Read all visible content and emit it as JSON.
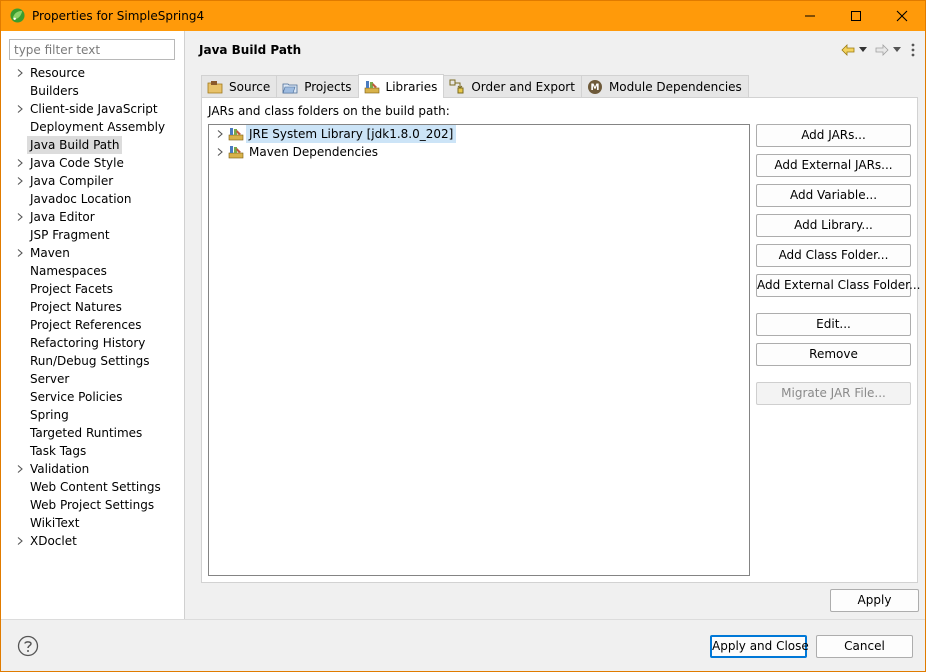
{
  "window": {
    "title": "Properties for SimpleSpring4",
    "controls": {
      "minimize": "minimize-icon",
      "maximize": "maximize-icon",
      "close": "close-icon"
    },
    "accent_color": "#ff9a0a"
  },
  "sidebar": {
    "filter_placeholder": "type filter text",
    "items": [
      {
        "label": "Resource",
        "expandable": true
      },
      {
        "label": "Builders",
        "expandable": false
      },
      {
        "label": "Client-side JavaScript",
        "expandable": true
      },
      {
        "label": "Deployment Assembly",
        "expandable": false
      },
      {
        "label": "Java Build Path",
        "expandable": false,
        "selected": true
      },
      {
        "label": "Java Code Style",
        "expandable": true
      },
      {
        "label": "Java Compiler",
        "expandable": true
      },
      {
        "label": "Javadoc Location",
        "expandable": false
      },
      {
        "label": "Java Editor",
        "expandable": true
      },
      {
        "label": "JSP Fragment",
        "expandable": false
      },
      {
        "label": "Maven",
        "expandable": true
      },
      {
        "label": "Namespaces",
        "expandable": false
      },
      {
        "label": "Project Facets",
        "expandable": false
      },
      {
        "label": "Project Natures",
        "expandable": false
      },
      {
        "label": "Project References",
        "expandable": false
      },
      {
        "label": "Refactoring History",
        "expandable": false
      },
      {
        "label": "Run/Debug Settings",
        "expandable": false
      },
      {
        "label": "Server",
        "expandable": false
      },
      {
        "label": "Service Policies",
        "expandable": false
      },
      {
        "label": "Spring",
        "expandable": false
      },
      {
        "label": "Targeted Runtimes",
        "expandable": false
      },
      {
        "label": "Task Tags",
        "expandable": false
      },
      {
        "label": "Validation",
        "expandable": true
      },
      {
        "label": "Web Content Settings",
        "expandable": false
      },
      {
        "label": "Web Project Settings",
        "expandable": false
      },
      {
        "label": "WikiText",
        "expandable": false
      },
      {
        "label": "XDoclet",
        "expandable": true
      }
    ]
  },
  "page": {
    "title": "Java Build Path",
    "tabs": [
      {
        "label": "Source",
        "icon": "source-folder-icon"
      },
      {
        "label": "Projects",
        "icon": "projects-icon"
      },
      {
        "label": "Libraries",
        "icon": "library-icon",
        "active": true
      },
      {
        "label": "Order and Export",
        "icon": "order-export-icon"
      },
      {
        "label": "Module Dependencies",
        "icon": "module-icon"
      }
    ],
    "caption": "JARs and class folders on the build path:",
    "tree": [
      {
        "label": "JRE System Library [jdk1.8.0_202]",
        "selected": true
      },
      {
        "label": "Maven Dependencies",
        "selected": false
      }
    ],
    "buttons": {
      "add_jars": "Add JARs...",
      "add_external_jars": "Add External JARs...",
      "add_variable": "Add Variable...",
      "add_library": "Add Library...",
      "add_class_folder": "Add Class Folder...",
      "add_external_class_folder": "Add External Class Folder...",
      "edit": "Edit...",
      "remove": "Remove",
      "migrate_jar": "Migrate JAR File..."
    },
    "apply": "Apply"
  },
  "footer": {
    "apply_and_close": "Apply and Close",
    "cancel": "Cancel"
  }
}
